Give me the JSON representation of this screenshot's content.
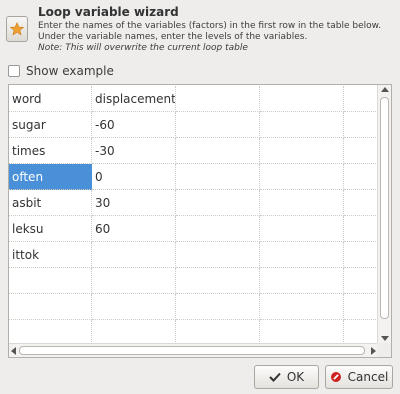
{
  "header": {
    "title": "Loop variable wizard",
    "line1": "Enter the names of the variables (factors) in the first row in the table below.",
    "line2": "Under the variable names, enter the levels of the variables.",
    "note": "Note: This will overwrite the current loop table",
    "icon": "star-icon",
    "icon_color": "#f0a030"
  },
  "options": {
    "show_example_label": "Show example",
    "show_example_checked": false
  },
  "table": {
    "rows": [
      [
        "word",
        "displacement",
        "",
        "",
        ""
      ],
      [
        "sugar",
        "-60",
        "",
        "",
        ""
      ],
      [
        "times",
        "-30",
        "",
        "",
        ""
      ],
      [
        "often",
        "0",
        "",
        "",
        ""
      ],
      [
        "asbit",
        "30",
        "",
        "",
        ""
      ],
      [
        "leksu",
        "60",
        "",
        "",
        ""
      ],
      [
        "ittok",
        "",
        "",
        "",
        ""
      ],
      [
        "",
        "",
        "",
        "",
        ""
      ],
      [
        "",
        "",
        "",
        "",
        ""
      ],
      [
        "",
        "",
        "",
        "",
        ""
      ]
    ],
    "selected_cell": {
      "row": 3,
      "col": 0
    },
    "selection_color": "#4a90d9"
  },
  "buttons": {
    "ok_label": "OK",
    "cancel_label": "Cancel",
    "ok_icon": "checkmark-icon",
    "cancel_icon": "cancel-icon",
    "cancel_icon_color": "#cc2222"
  }
}
